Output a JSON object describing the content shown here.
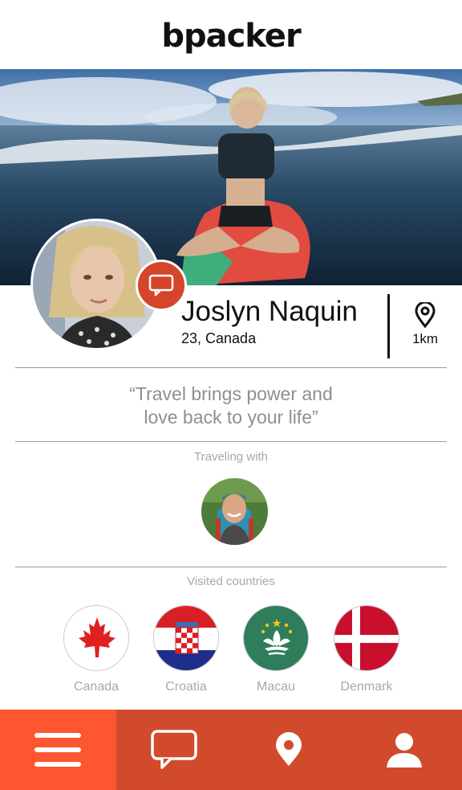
{
  "app": {
    "logo": "bpacker"
  },
  "profile": {
    "name": "Joslyn Naquin",
    "age_country": "23, Canada",
    "distance": "1km",
    "quote_line1": "“Travel brings power and",
    "quote_line2": "love back to your life”"
  },
  "traveling_with": {
    "label": "Traveling with"
  },
  "visited": {
    "label": "Visited countries",
    "countries": [
      {
        "name": "Canada"
      },
      {
        "name": "Croatia"
      },
      {
        "name": "Macau"
      },
      {
        "name": "Denmark"
      }
    ]
  },
  "nav": {
    "items": [
      "menu-icon",
      "chat-icon",
      "location-icon",
      "profile-icon"
    ],
    "active_color": "#fe5631",
    "bar_color": "#d14a2b"
  },
  "colors": {
    "accent": "#d5452a"
  }
}
